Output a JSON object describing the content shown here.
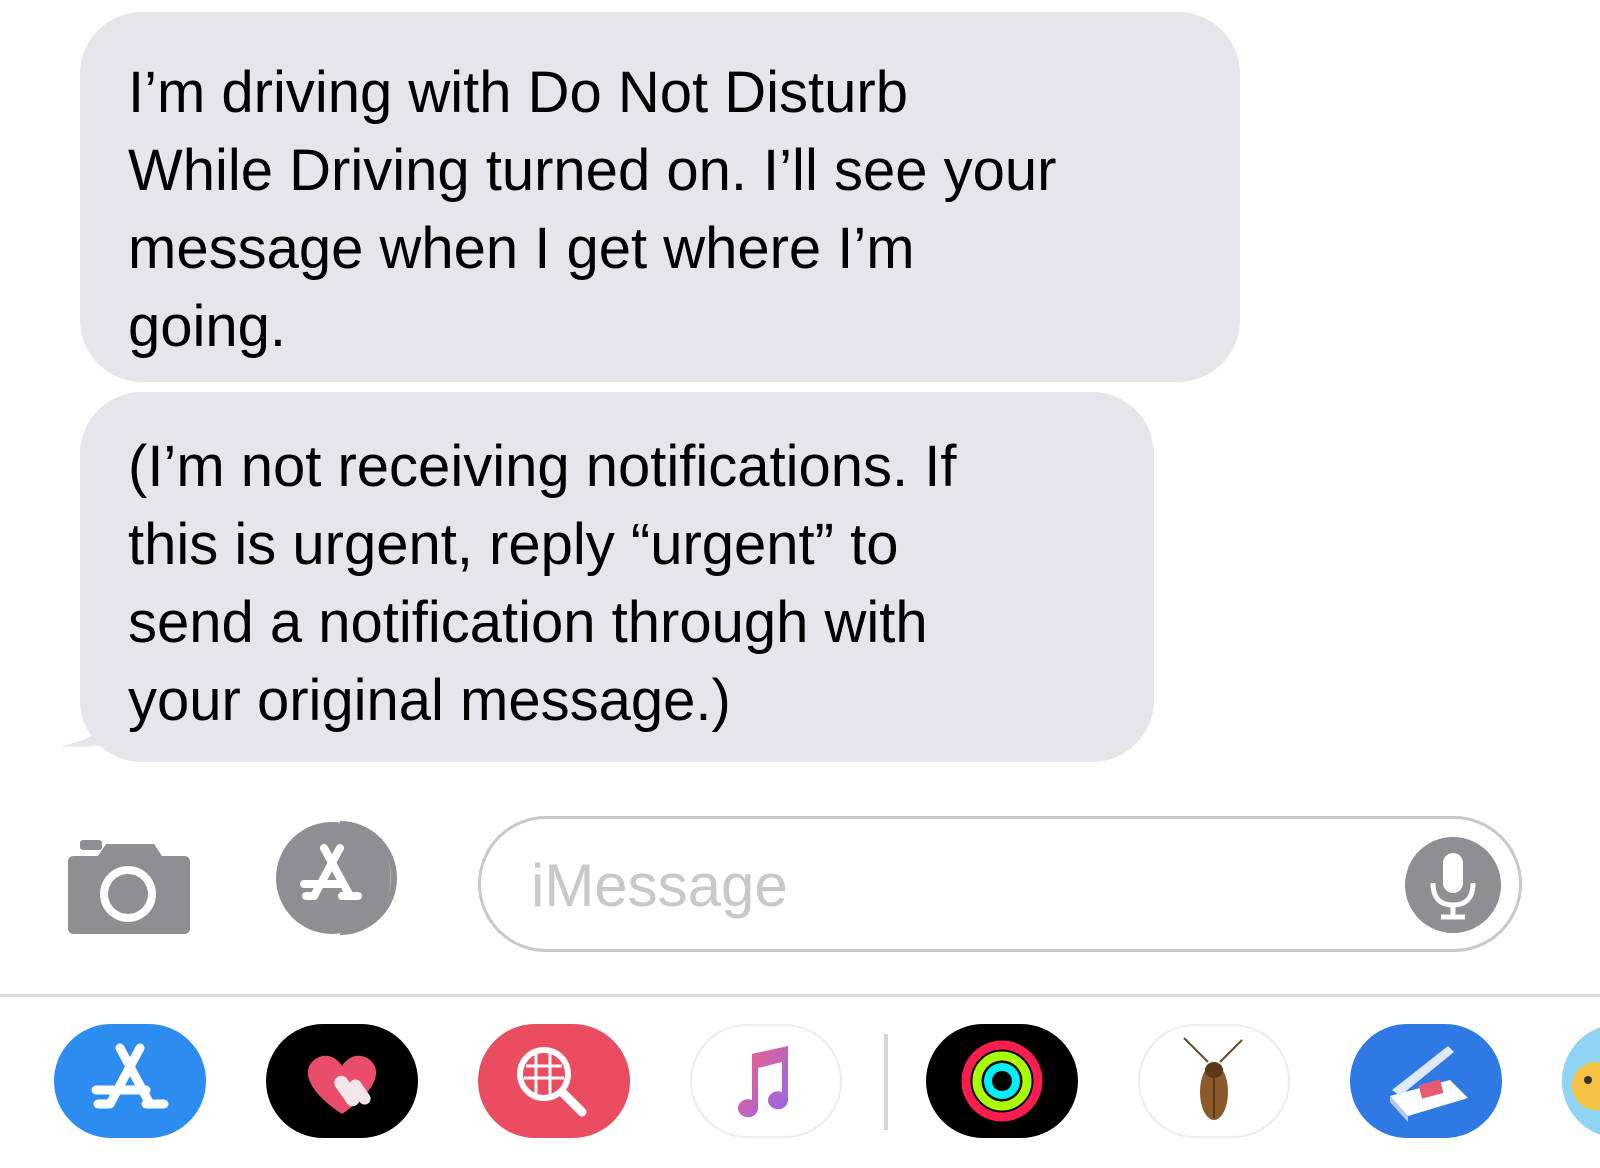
{
  "messages": [
    {
      "direction": "incoming",
      "lines": [
        "I’m driving with Do Not Disturb",
        "While Driving turned on. I’ll see your",
        "message when I get where I’m",
        "going."
      ]
    },
    {
      "direction": "incoming",
      "lines": [
        "(I’m not receiving notifications. If",
        "this is urgent, reply “urgent” to",
        "send a notification through with",
        "your original message.)"
      ]
    }
  ],
  "input": {
    "placeholder": "iMessage"
  },
  "icons": {
    "camera": "camera-icon",
    "apps": "app-store-icon",
    "mic": "microphone-icon"
  },
  "app_drawer": [
    "app-store-icon",
    "digital-touch-icon",
    "image-search-icon",
    "music-icon",
    "activity-icon",
    "sticker-icon",
    "scanner-icon",
    "sticker-app-icon"
  ],
  "colors": {
    "incoming_bubble": "#e5e5ea",
    "placeholder": "#c7c7cc",
    "icon_gray": "#8e8e93",
    "app_store_blue": "#2d8cf0",
    "images_red": "#ea4d5f"
  }
}
